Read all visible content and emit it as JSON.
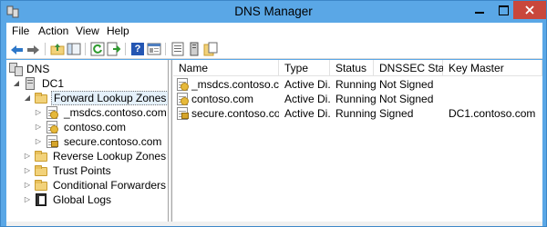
{
  "window": {
    "title": "DNS Manager"
  },
  "menu": {
    "items": [
      "File",
      "Action",
      "View",
      "Help"
    ]
  },
  "tree": {
    "root": "DNS",
    "server": "DC1",
    "forward": "Forward Lookup Zones",
    "zones": [
      "_msdcs.contoso.com",
      "contoso.com",
      "secure.contoso.com"
    ],
    "reverse": "Reverse Lookup Zones",
    "trust": "Trust Points",
    "conditional": "Conditional Forwarders",
    "logs": "Global Logs"
  },
  "list": {
    "columns": [
      "Name",
      "Type",
      "Status",
      "DNSSEC Status",
      "Key Master"
    ],
    "rows": [
      {
        "name": "_msdcs.contoso.com",
        "type": "Active Di...",
        "status": "Running",
        "dnssec": "Not Signed",
        "key_master": "",
        "icon": "zone-icon"
      },
      {
        "name": "contoso.com",
        "type": "Active Di...",
        "status": "Running",
        "dnssec": "Not Signed",
        "key_master": "",
        "icon": "zone-icon"
      },
      {
        "name": "secure.contoso.com",
        "type": "Active Di...",
        "status": "Running",
        "dnssec": "Signed",
        "key_master": "DC1.contoso.com",
        "icon": "signed-zone-icon"
      }
    ]
  },
  "colors": {
    "titlebar": "#5aa7e6",
    "close": "#c9473b",
    "selection": "#e5f1fb"
  }
}
